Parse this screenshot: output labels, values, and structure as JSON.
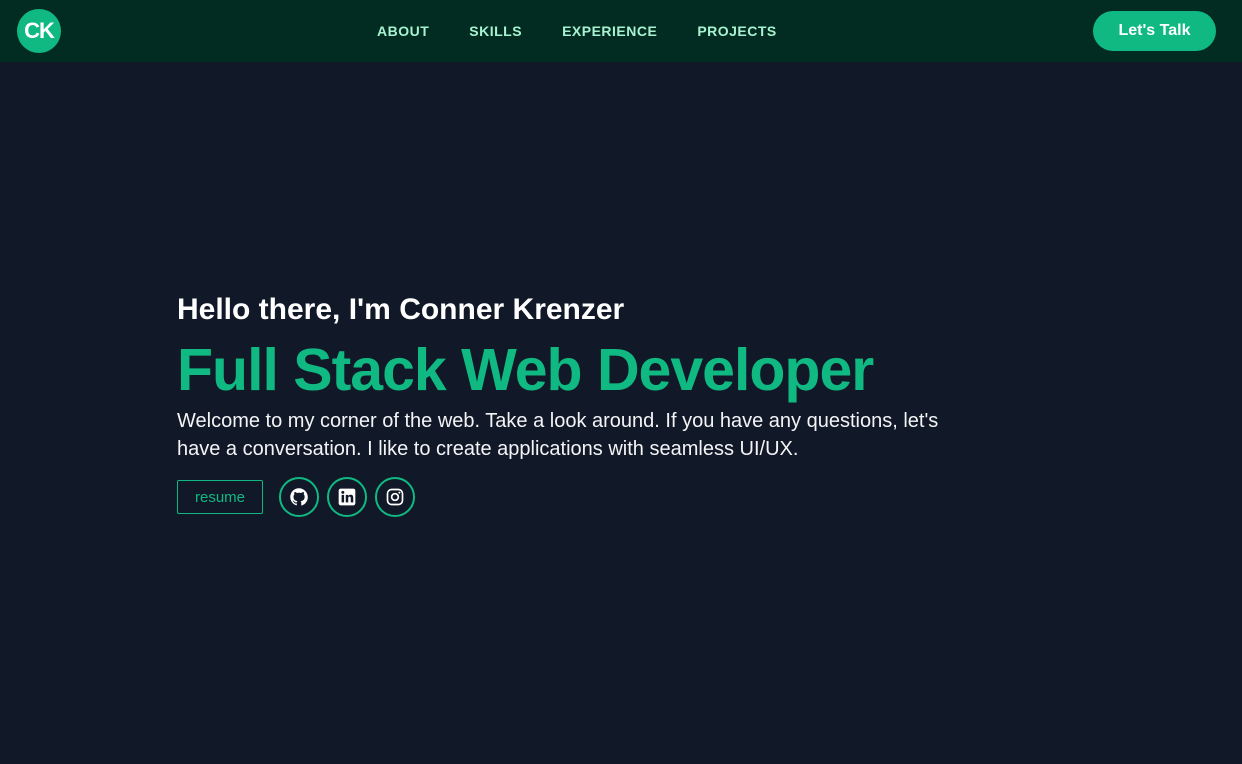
{
  "nav": {
    "logo_text": "CK",
    "links": [
      {
        "label": "ABOUT"
      },
      {
        "label": "SKILLS"
      },
      {
        "label": "EXPERIENCE"
      },
      {
        "label": "PROJECTS"
      }
    ],
    "cta_label": "Let's Talk"
  },
  "hero": {
    "greeting": "Hello there, I'm Conner Krenzer",
    "role": "Full Stack Web Developer",
    "intro_line1": "Welcome to my corner of the web. Take a look around. If you have any questions, let's",
    "intro_line2": "have a conversation. I like to create applications with seamless UI/UX.",
    "resume_label": "resume",
    "socials": [
      {
        "icon": "github-icon"
      },
      {
        "icon": "linkedin-icon"
      },
      {
        "icon": "instagram-icon"
      }
    ]
  },
  "colors": {
    "background": "#111827",
    "navbar": "#022c22",
    "accent": "#10b981",
    "nav_text": "#a7f3d0"
  }
}
